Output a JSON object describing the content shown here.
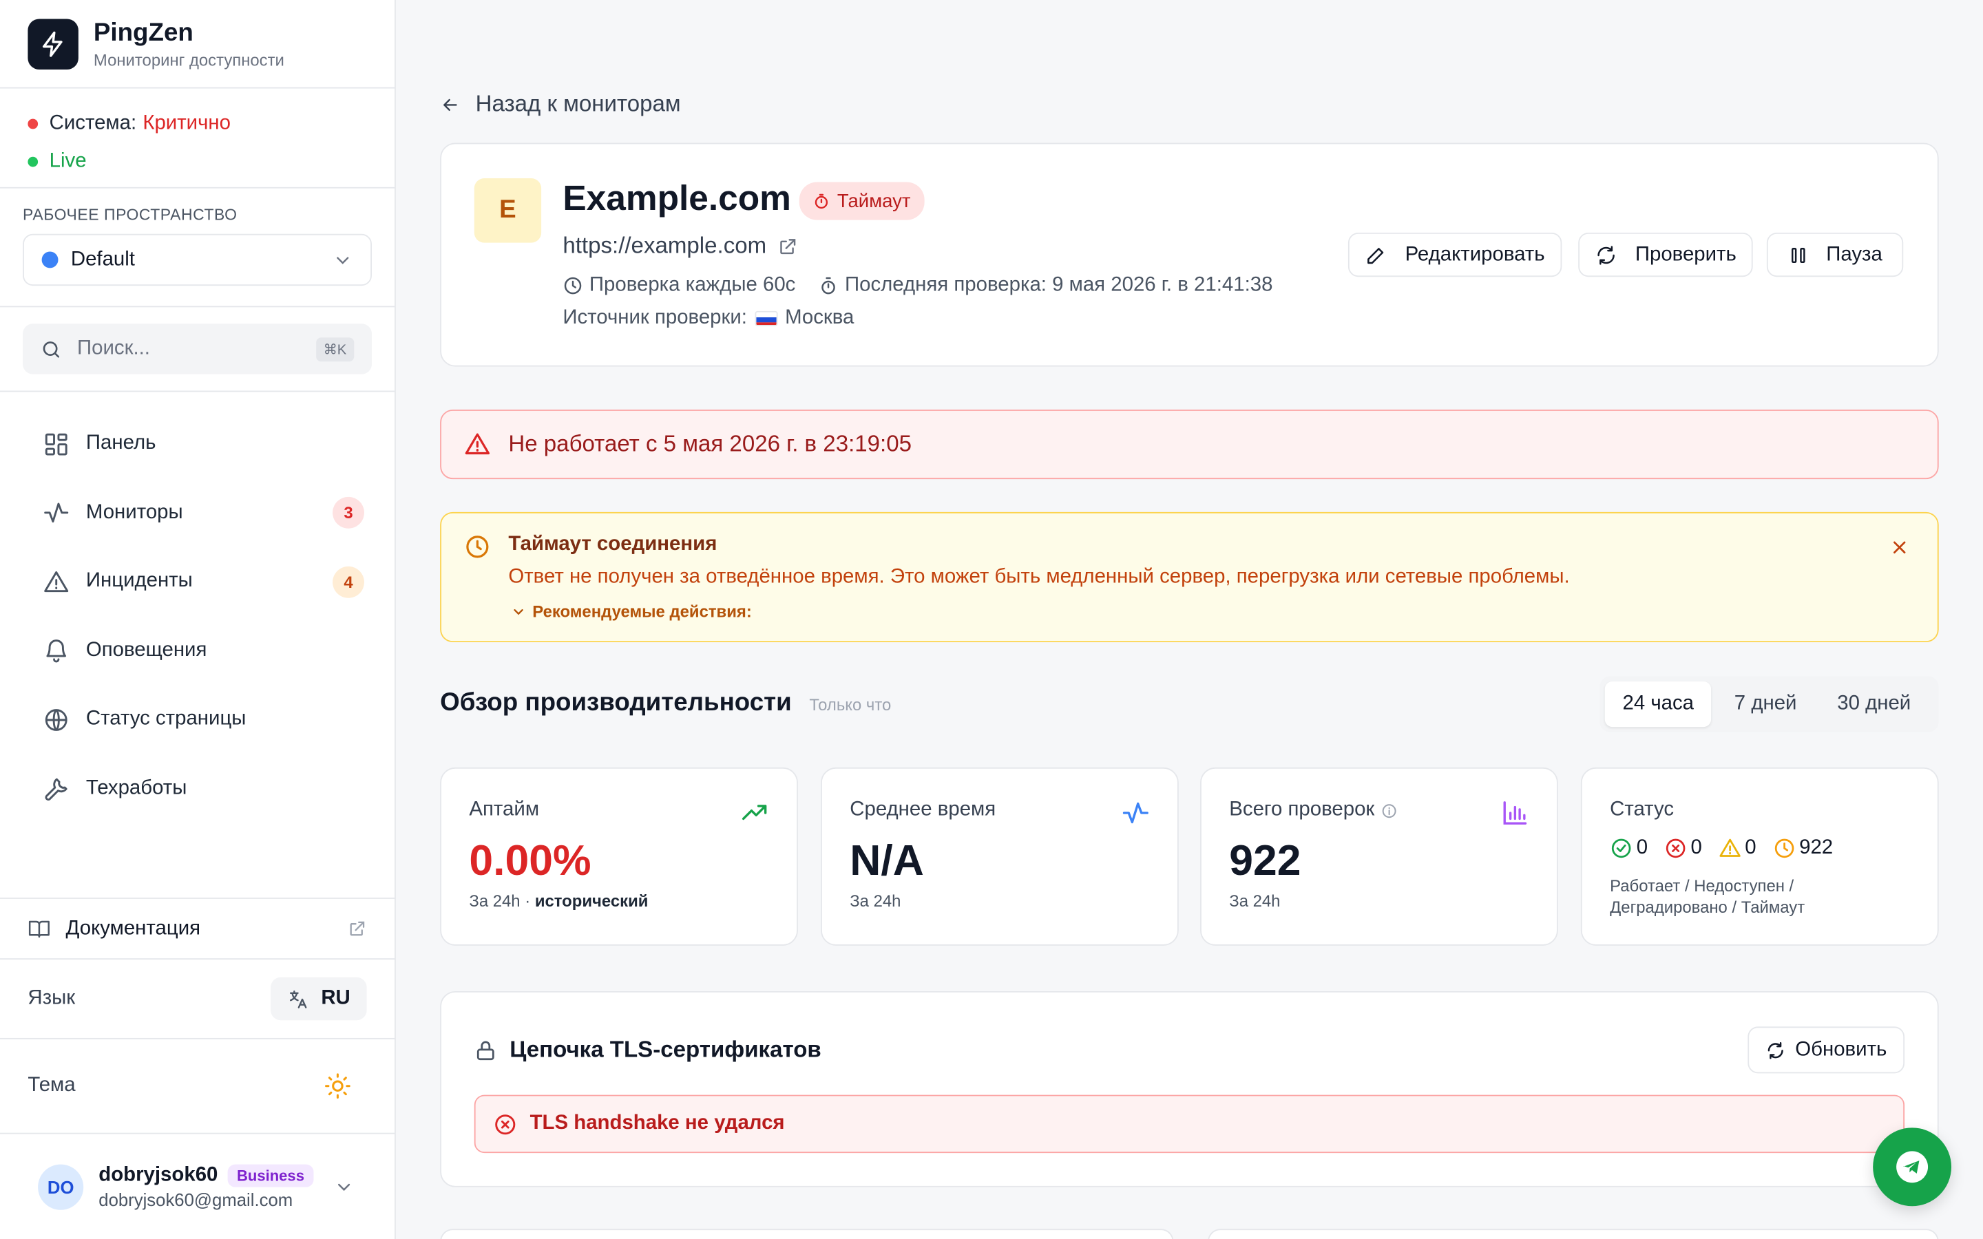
{
  "brand": {
    "name": "PingZen",
    "subtitle": "Мониторинг доступности"
  },
  "system": {
    "label": "Система:",
    "status": "Критично",
    "live": "Live",
    "status_color": "#dc2626",
    "live_color": "#16a34a"
  },
  "workspace": {
    "label": "РАБОЧЕЕ ПРОСТРАНСТВО",
    "value": "Default"
  },
  "search": {
    "placeholder": "Поиск...",
    "shortcut": "⌘K"
  },
  "nav": [
    {
      "label": "Панель",
      "icon": "dashboard-icon"
    },
    {
      "label": "Мониторы",
      "icon": "activity-icon",
      "badge": "3"
    },
    {
      "label": "Инциденты",
      "icon": "alert-triangle-icon",
      "badge": "4"
    },
    {
      "label": "Оповещения",
      "icon": "bell-icon"
    },
    {
      "label": "Статус страницы",
      "icon": "globe-icon"
    },
    {
      "label": "Техработы",
      "icon": "wrench-icon"
    }
  ],
  "sidebar_bottom": {
    "docs": "Документация",
    "language_label": "Язык",
    "language_value": "RU",
    "theme_label": "Тема",
    "user": {
      "initials": "DO",
      "name": "dobryjsok60",
      "plan": "Business",
      "email": "dobryjsok60@gmail.com"
    }
  },
  "back_link": "Назад к мониторам",
  "monitor": {
    "letter": "E",
    "name": "Example.com",
    "status": "Таймаут",
    "url": "https://example.com",
    "interval": "Проверка каждые 60с",
    "last_check": "Последняя проверка: 9 мая 2026 г. в 21:41:38",
    "source_label": "Источник проверки:",
    "source_city": "Москва",
    "actions": {
      "edit": "Редактировать",
      "check": "Проверить",
      "pause": "Пауза"
    }
  },
  "down_alert": "Не работает с 5 мая 2026 г. в 23:19:05",
  "timeout_alert": {
    "title": "Таймаут соединения",
    "message": "Ответ не получен за отведённое время. Это может быть медленный сервер, перегрузка или сетевые проблемы.",
    "recommendations": "Рекомендуемые действия:"
  },
  "performance": {
    "title": "Обзор производительности",
    "updated": "Только что",
    "tabs": [
      "24 часа",
      "7 дней",
      "30 дней"
    ],
    "active_tab": "24 часа",
    "uptime": {
      "label": "Аптайм",
      "value": "0.00%",
      "sub": "За 24h ·",
      "sub_bold": "исторический"
    },
    "avg_time": {
      "label": "Среднее время",
      "value": "N/A",
      "sub": "За 24h"
    },
    "total_checks": {
      "label": "Всего проверок",
      "value": "922",
      "sub": "За 24h"
    },
    "status": {
      "label": "Статус",
      "up": "0",
      "down": "0",
      "degraded": "0",
      "timeout": "922",
      "legend_line1": "Работает / Недоступен /",
      "legend_line2": "Деградировано / Таймаут"
    }
  },
  "tls": {
    "title": "Цепочка TLS-сертификатов",
    "refresh": "Обновить",
    "error": "TLS handshake не удался"
  },
  "colors": {
    "danger": "#dc2626",
    "warning": "#c2410c",
    "success": "#16a34a",
    "primary": "#3b82f6"
  }
}
